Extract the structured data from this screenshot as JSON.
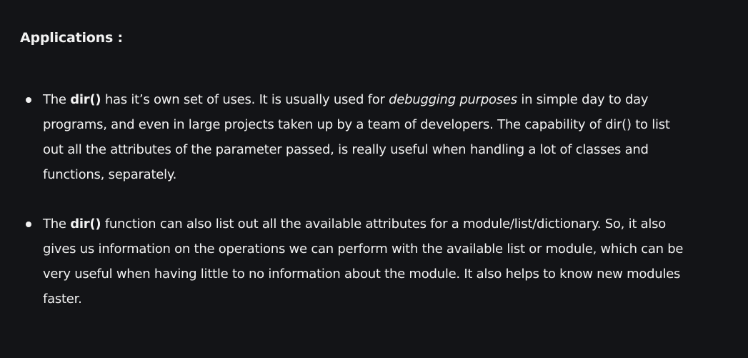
{
  "section": {
    "heading": "Applications :"
  },
  "bullets": [
    {
      "lead": "The ",
      "term": "dir()",
      "text_a": " has it’s own set of uses. It is usually used for ",
      "emphasis": "debugging purposes",
      "text_b": " in simple day to day programs, and even in large projects taken up by a team of developers. The capability of dir() to list out all the attributes of the parameter passed, is really useful when handling a lot of classes and functions, separately."
    },
    {
      "lead": "The ",
      "term": "dir()",
      "text_a": " function can also list out all the available attributes for a module/list/dictionary. So, it also gives us information on the operations we can perform with the available list or module, which can be very useful when having little to no information about the module. It also helps to know new modules faster."
    }
  ]
}
